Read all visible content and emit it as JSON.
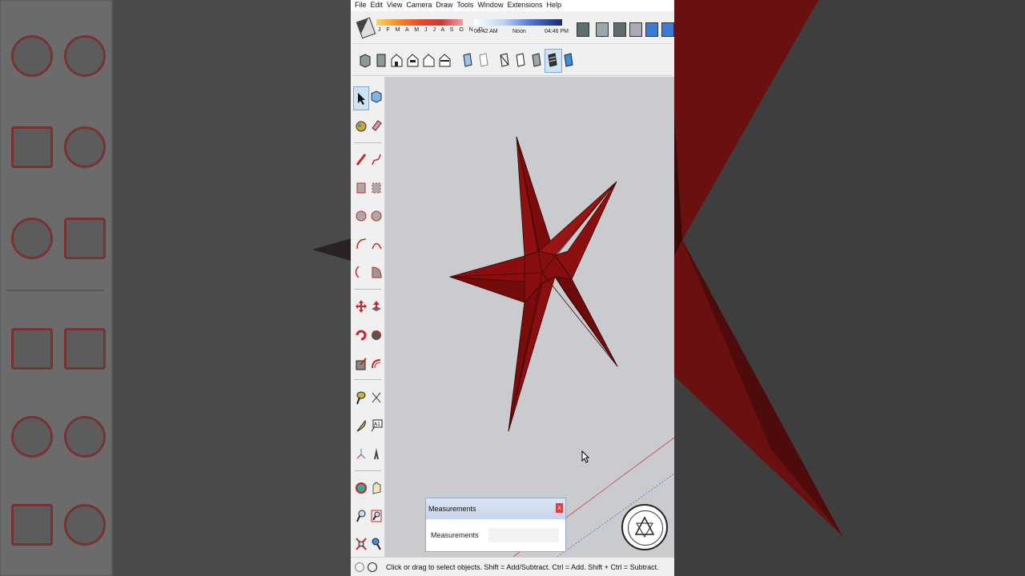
{
  "menu": [
    "File",
    "Edit",
    "View",
    "Camera",
    "Draw",
    "Tools",
    "Window",
    "Extensions",
    "Help"
  ],
  "shadows": {
    "months": "J F M A M J J A S O N D",
    "time_start": "06:42 AM",
    "time_mid": "Noon",
    "time_end": "04:46 PM"
  },
  "measurements": {
    "title": "Measurements",
    "label": "Measurements",
    "close": "x"
  },
  "status": {
    "text": "Click or drag to select objects. Shift = Add/Subtract. Ctrl = Add. Shift + Ctrl = Subtract."
  },
  "colors": {
    "star_fill": "#8b0d0d",
    "star_edge": "#3a0505",
    "viewport_bg": "#c9cbcf",
    "accent_red": "#c62828"
  },
  "icons": {
    "toolbar_left": [
      "select-icon",
      "component-icon",
      "paint-bucket-icon",
      "eraser-icon",
      "pencil-icon",
      "freehand-icon",
      "rectangle-icon",
      "rotated-rectangle-icon",
      "circle-icon",
      "polygon-icon",
      "arc-icon",
      "arc-2pt-icon",
      "arc-3pt-icon",
      "pie-icon",
      "move-icon",
      "push-pull-icon",
      "rotate-icon",
      "follow-me-icon",
      "scale-icon",
      "offset-icon",
      "tape-measure-icon",
      "dimension-icon",
      "protractor-icon",
      "text-icon",
      "axes-icon",
      "3d-text-icon",
      "orbit-icon",
      "pan-icon",
      "zoom-icon",
      "zoom-window-icon",
      "zoom-extents-icon",
      "previous-view-icon"
    ]
  }
}
